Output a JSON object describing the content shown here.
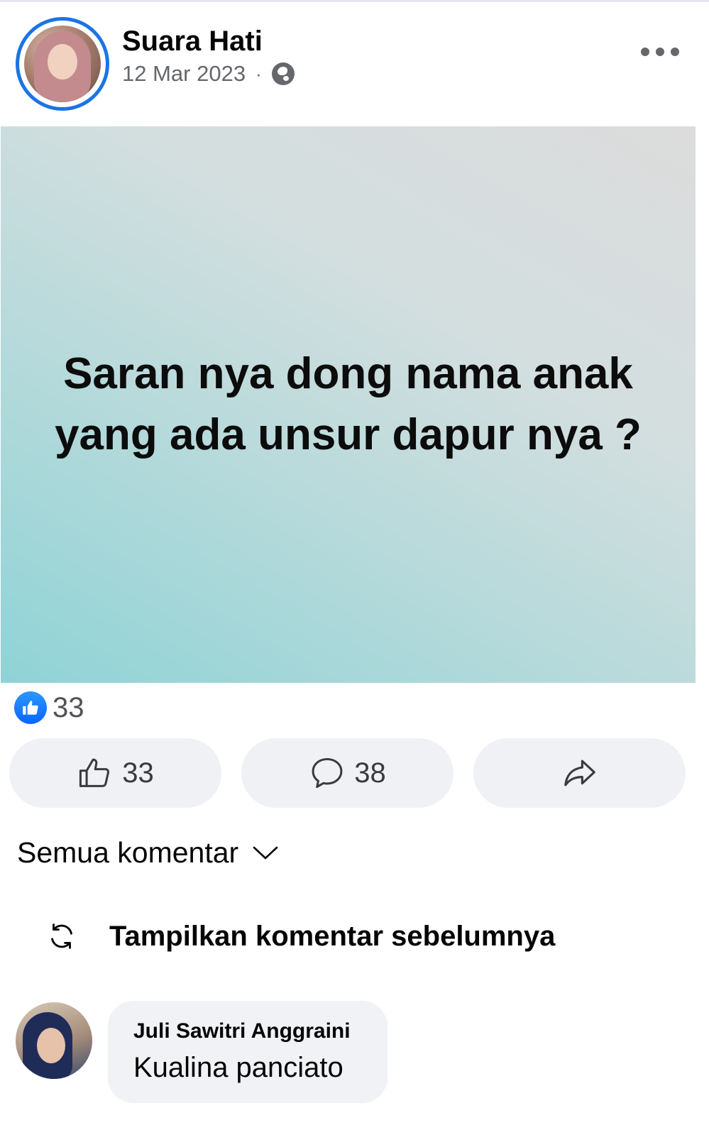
{
  "post": {
    "author": "Suara Hati",
    "date": "12 Mar 2023",
    "separator": "·",
    "privacy_icon": "globe-icon",
    "text": "Saran nya dong nama anak yang ada unsur dapur nya ?",
    "background_colors": [
      "#8fd3d6",
      "#dcdcdc"
    ]
  },
  "reactions": {
    "icon": "like-reaction-icon",
    "count": "33"
  },
  "actions": {
    "like_count": "33",
    "comment_count": "38",
    "share_icon": "share-icon"
  },
  "comments": {
    "sort_label": "Semua komentar",
    "previous_label": "Tampilkan komentar sebelumnya",
    "items": [
      {
        "author": "Juli Sawitri Anggraini",
        "text": "Kualina panciato"
      }
    ]
  },
  "colors": {
    "accent": "#1b74e4",
    "like_blue": "#0866ff",
    "button_bg": "#eff1f5"
  }
}
